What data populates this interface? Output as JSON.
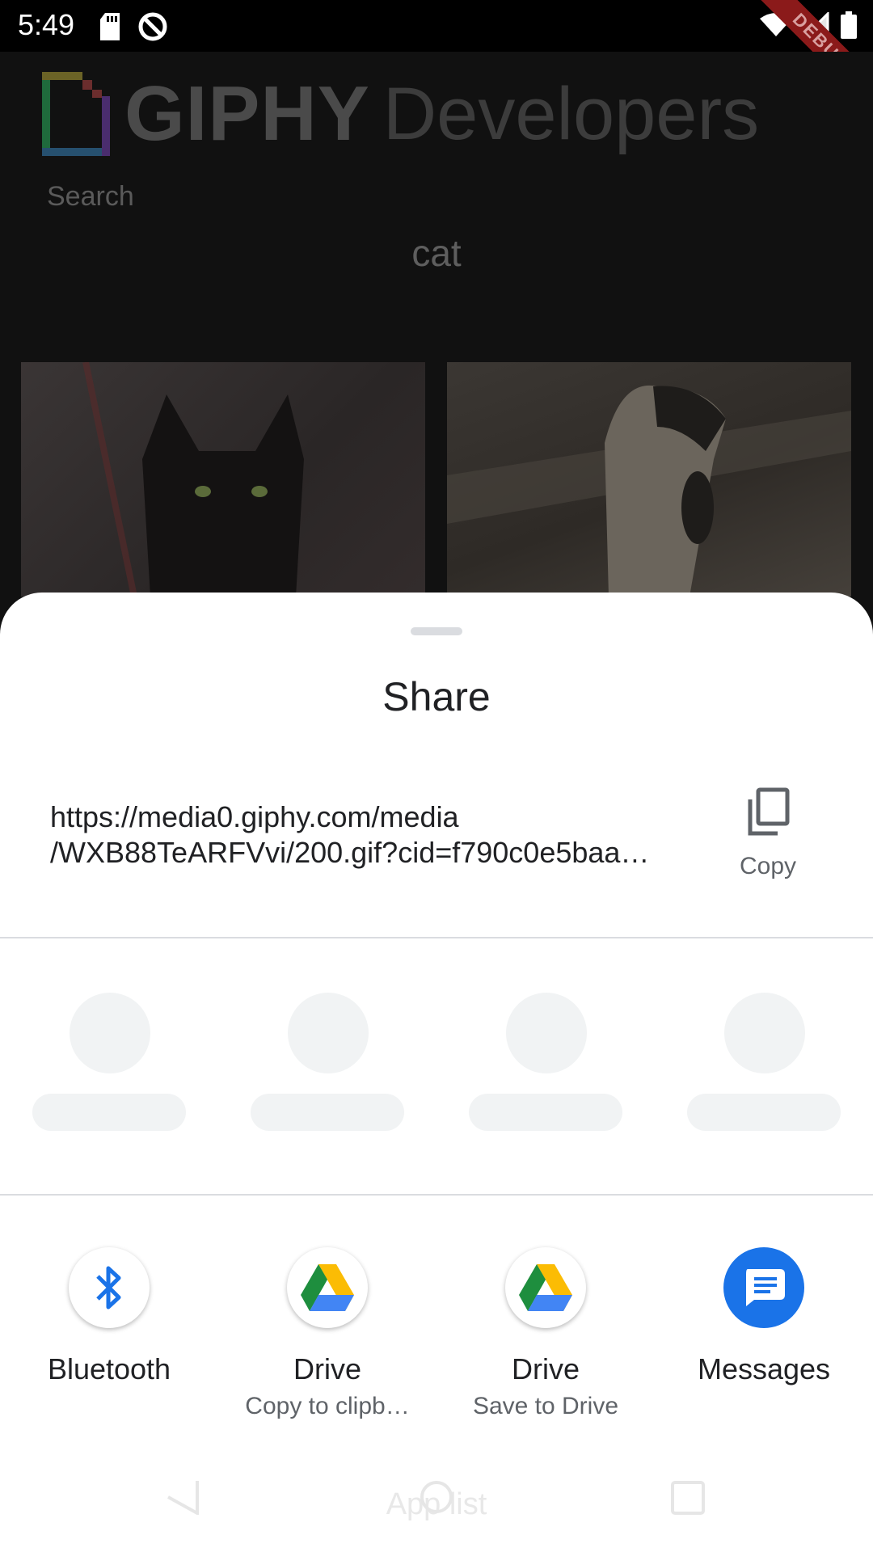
{
  "status_bar": {
    "time": "5:49",
    "debug_badge": "DEBUG"
  },
  "background_app": {
    "logo_title": "GIPHY",
    "logo_subtitle": "Developers",
    "search_label": "Search",
    "search_value": "cat"
  },
  "share_sheet": {
    "title": "Share",
    "url_line1": "https://media0.giphy.com/media",
    "url_line2": "/WXB88TeARFVvi/200.gif?cid=f790c0e5baa…",
    "copy_label": "Copy",
    "targets": [
      {
        "label": "Bluetooth",
        "sublabel": "",
        "icon": "bluetooth-icon"
      },
      {
        "label": "Drive",
        "sublabel": "Copy to clipb…",
        "icon": "google-drive-icon"
      },
      {
        "label": "Drive",
        "sublabel": "Save to Drive",
        "icon": "google-drive-icon"
      },
      {
        "label": "Messages",
        "sublabel": "",
        "icon": "messages-icon"
      }
    ]
  },
  "nav_bar": {
    "label": "App list"
  },
  "colors": {
    "accent_blue": "#1a73e8",
    "drive_green": "#1e8e3e",
    "drive_yellow": "#fbbc04",
    "drive_blue": "#4285f4",
    "debug_red": "#8b1a1a"
  }
}
